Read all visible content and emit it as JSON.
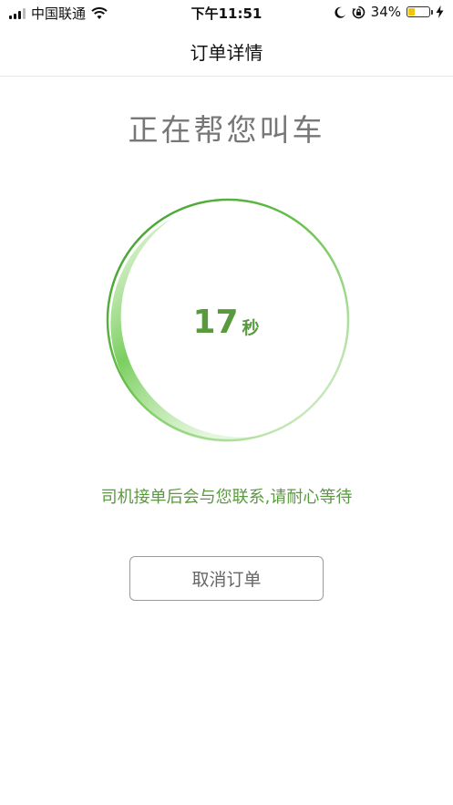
{
  "status_bar": {
    "carrier": "中国联通",
    "time": "下午11:51",
    "battery_percent_text": "34%",
    "battery_level": 0.34,
    "icons": [
      "signal-icon",
      "wifi-icon",
      "moon-icon",
      "rotation-lock-icon",
      "battery-icon",
      "charging-icon"
    ]
  },
  "nav": {
    "title": "订单详情"
  },
  "main": {
    "headline": "正在帮您叫车",
    "countdown_value": "17",
    "countdown_unit": "秒",
    "hint": "司机接单后会与您联系,请耐心等待",
    "cancel_label": "取消订单"
  },
  "colors": {
    "accent_green": "#5a9a3f",
    "ring_green": "#66c24a",
    "battery_yellow": "#f1c40f"
  }
}
